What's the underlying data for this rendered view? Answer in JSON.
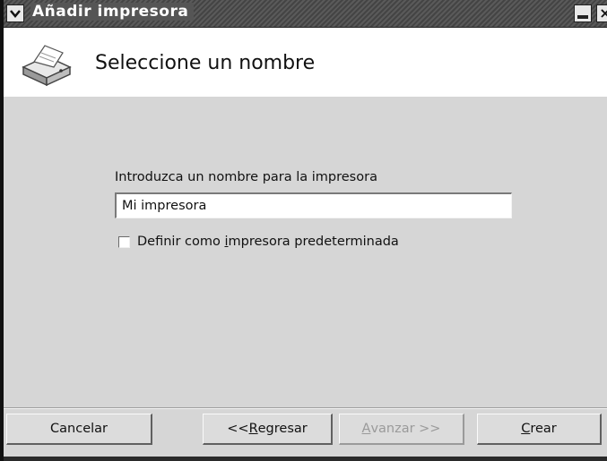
{
  "window": {
    "title": "Añadir impresora",
    "close_glyph": "×"
  },
  "header": {
    "title": "Seleccione un nombre",
    "icon": "printer-icon"
  },
  "form": {
    "name_label": "Introduzca un nombre para la impresora",
    "name_value": "Mi impresora",
    "default_checkbox": {
      "label_pre": "Definir como ",
      "label_mnemonic": "i",
      "label_post": "mpresora predeterminada",
      "checked": false
    }
  },
  "buttons": {
    "cancel": "Cancelar",
    "back_pre": "<< ",
    "back_mnemonic": "R",
    "back_post": "egresar",
    "next_mnemonic": "A",
    "next_post": "vanzar >>",
    "create_mnemonic": "C",
    "create_post": "rear"
  },
  "colors": {
    "header_bg": "#ffffff",
    "body_bg": "#d6d6d6",
    "disabled_text": "#9a9a9a"
  }
}
